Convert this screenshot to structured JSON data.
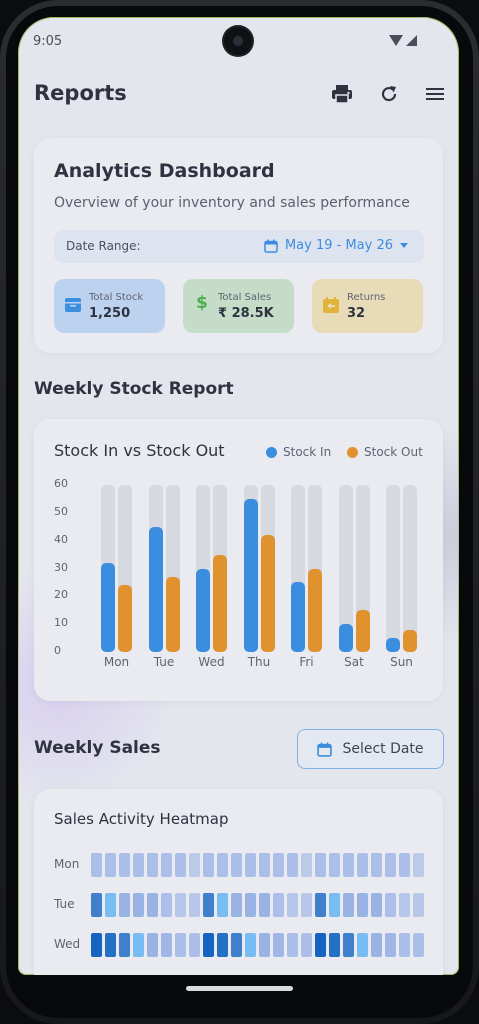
{
  "status_bar": {
    "time": "9:05"
  },
  "app_bar": {
    "title": "Reports",
    "print_icon": "print-icon",
    "refresh_icon": "refresh-icon",
    "menu_icon": "menu-icon"
  },
  "dashboard": {
    "title": "Analytics Dashboard",
    "subtitle": "Overview of your inventory and sales performance",
    "date_range_label": "Date Range:",
    "date_range_value": "May 19 - May 26",
    "stats": [
      {
        "label": "Total Stock",
        "value": "1,250",
        "icon": "archive-icon",
        "color": "#3b8fe0",
        "bg": "#bdd2ee"
      },
      {
        "label": "Total Sales",
        "value": "₹ 28.5K",
        "icon": "dollar-icon",
        "color": "#4caf50",
        "bg": "#c4dcc8"
      },
      {
        "label": "Returns",
        "value": "32",
        "icon": "return-icon",
        "color": "#e2b33a",
        "bg": "#e8dcb8"
      }
    ]
  },
  "weekly_stock": {
    "section_title": "Weekly Stock Report",
    "chart_title": "Stock In vs Stock Out"
  },
  "chart_data": {
    "type": "bar",
    "title": "Stock In vs Stock Out",
    "categories": [
      "Mon",
      "Tue",
      "Wed",
      "Thu",
      "Fri",
      "Sat",
      "Sun"
    ],
    "series": [
      {
        "name": "Stock In",
        "color": "#3b8de0",
        "values": [
          32,
          45,
          30,
          55,
          25,
          10,
          5
        ]
      },
      {
        "name": "Stock Out",
        "color": "#e0922e",
        "values": [
          24,
          27,
          35,
          42,
          30,
          15,
          8
        ]
      }
    ],
    "yticks": [
      "60",
      "50",
      "40",
      "30",
      "20",
      "10",
      "0"
    ],
    "ylim": [
      0,
      60
    ],
    "legend": "top-right",
    "grid": false
  },
  "weekly_sales": {
    "section_title": "Weekly Sales",
    "select_date_label": "Select Date",
    "select_date_icon": "calendar-icon",
    "heatmap_title": "Sales Activity Heatmap",
    "days": [
      "Mon",
      "Tue",
      "Wed"
    ],
    "heatmap_levels": [
      [
        0.3,
        0.3,
        0.3,
        0.3,
        0.3,
        0.3,
        0.3,
        0.15,
        0.3,
        0.3,
        0.3,
        0.3,
        0.3,
        0.3,
        0.3,
        0.15,
        0.3,
        0.3,
        0.3,
        0.3,
        0.3,
        0.3,
        0.3,
        0.15
      ],
      [
        0.75,
        0.6,
        0.45,
        0.45,
        0.45,
        0.3,
        0.2,
        0.2,
        0.75,
        0.6,
        0.45,
        0.45,
        0.45,
        0.3,
        0.2,
        0.2,
        0.75,
        0.6,
        0.45,
        0.45,
        0.45,
        0.3,
        0.2,
        0.2
      ],
      [
        1.0,
        0.9,
        0.75,
        0.6,
        0.45,
        0.4,
        0.3,
        0.3,
        1.0,
        0.9,
        0.75,
        0.6,
        0.45,
        0.4,
        0.3,
        0.3,
        1.0,
        0.9,
        0.75,
        0.6,
        0.45,
        0.4,
        0.3,
        0.3
      ]
    ]
  }
}
